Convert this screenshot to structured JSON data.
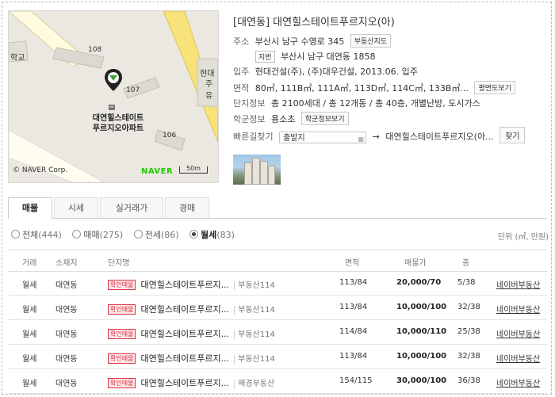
{
  "map": {
    "school_label": "학교",
    "building_108": "108",
    "building_107": "107",
    "building_106": "106",
    "hyundai_label": "현대",
    "hyundai_label2": "주유",
    "complex_label_1": "대연힐스테이트",
    "complex_label_2": "푸르지오아파트",
    "copyright": "© NAVER Corp.",
    "logo": "NAVER",
    "scale": "50m"
  },
  "info": {
    "title_prefix": "[대연동]",
    "title": "대연힐스테이트푸르지오(아)",
    "address_label": "주소",
    "address": "부산시 남구 수영로 345",
    "address_map_btn": "부동산지도",
    "lot_tag": "지번",
    "lot_address": "부산시 남구 대연동 1858",
    "move_in_label": "입주",
    "move_in": "현대건설(주), (주)대우건설, 2013.06. 입주",
    "area_label": "면적",
    "area": "80㎡, 111B㎡, 111A㎡, 113D㎡, 114C㎡, 133B㎡...",
    "floor_plan_btn": "평면도보기",
    "complex_label": "단지정보",
    "complex": "총 2100세대 / 총 12개동 / 총 40층, 개별난방, 도시가스",
    "school_info_label": "학군정보",
    "school": "용소초",
    "school_btn": "학군정보보기",
    "route_label": "빠른길찾기",
    "route_from": "출발지",
    "route_arrow": "→",
    "route_to": "대연힐스테이트푸르지오(아...",
    "route_btn": "찾기"
  },
  "tabs": [
    "매물",
    "시세",
    "실거래가",
    "경매"
  ],
  "filters": [
    {
      "label": "전체",
      "count": "(444)",
      "selected": false
    },
    {
      "label": "매매",
      "count": "(275)",
      "selected": false
    },
    {
      "label": "전세",
      "count": "(86)",
      "selected": false
    },
    {
      "label": "월세",
      "count": "(83)",
      "selected": true
    }
  ],
  "unit_note": "단위 (㎡, 만원)",
  "table": {
    "headers": [
      "거래",
      "소재지",
      "단지명",
      "면적",
      "매물가",
      "층"
    ],
    "rows": [
      {
        "type": "월세",
        "location": "대연동",
        "badge": "확인매물",
        "name": "대연힐스테이트푸르지...",
        "agent": "부동산114",
        "area": "113/84",
        "price": "20,000/70",
        "floor": "5/38",
        "link": "네이버부동산"
      },
      {
        "type": "월세",
        "location": "대연동",
        "badge": "확인매물",
        "name": "대연힐스테이트푸르지...",
        "agent": "부동산114",
        "area": "113/84",
        "price": "10,000/100",
        "floor": "32/38",
        "link": "네이버부동산"
      },
      {
        "type": "월세",
        "location": "대연동",
        "badge": "확인매물",
        "name": "대연힐스테이트푸르지...",
        "agent": "부동산114",
        "area": "114/84",
        "price": "10,000/110",
        "floor": "25/38",
        "link": "네이버부동산"
      },
      {
        "type": "월세",
        "location": "대연동",
        "badge": "확인매물",
        "name": "대연힐스테이트푸르지...",
        "agent": "부동산114",
        "area": "113/84",
        "price": "10,000/100",
        "floor": "32/38",
        "link": "네이버부동산"
      },
      {
        "type": "월세",
        "location": "대연동",
        "badge": "확인매물",
        "name": "대연힐스테이트푸르지...",
        "agent": "매경부동산",
        "area": "154/115",
        "price": "30,000/100",
        "floor": "36/38",
        "link": "네이버부동산"
      }
    ]
  }
}
